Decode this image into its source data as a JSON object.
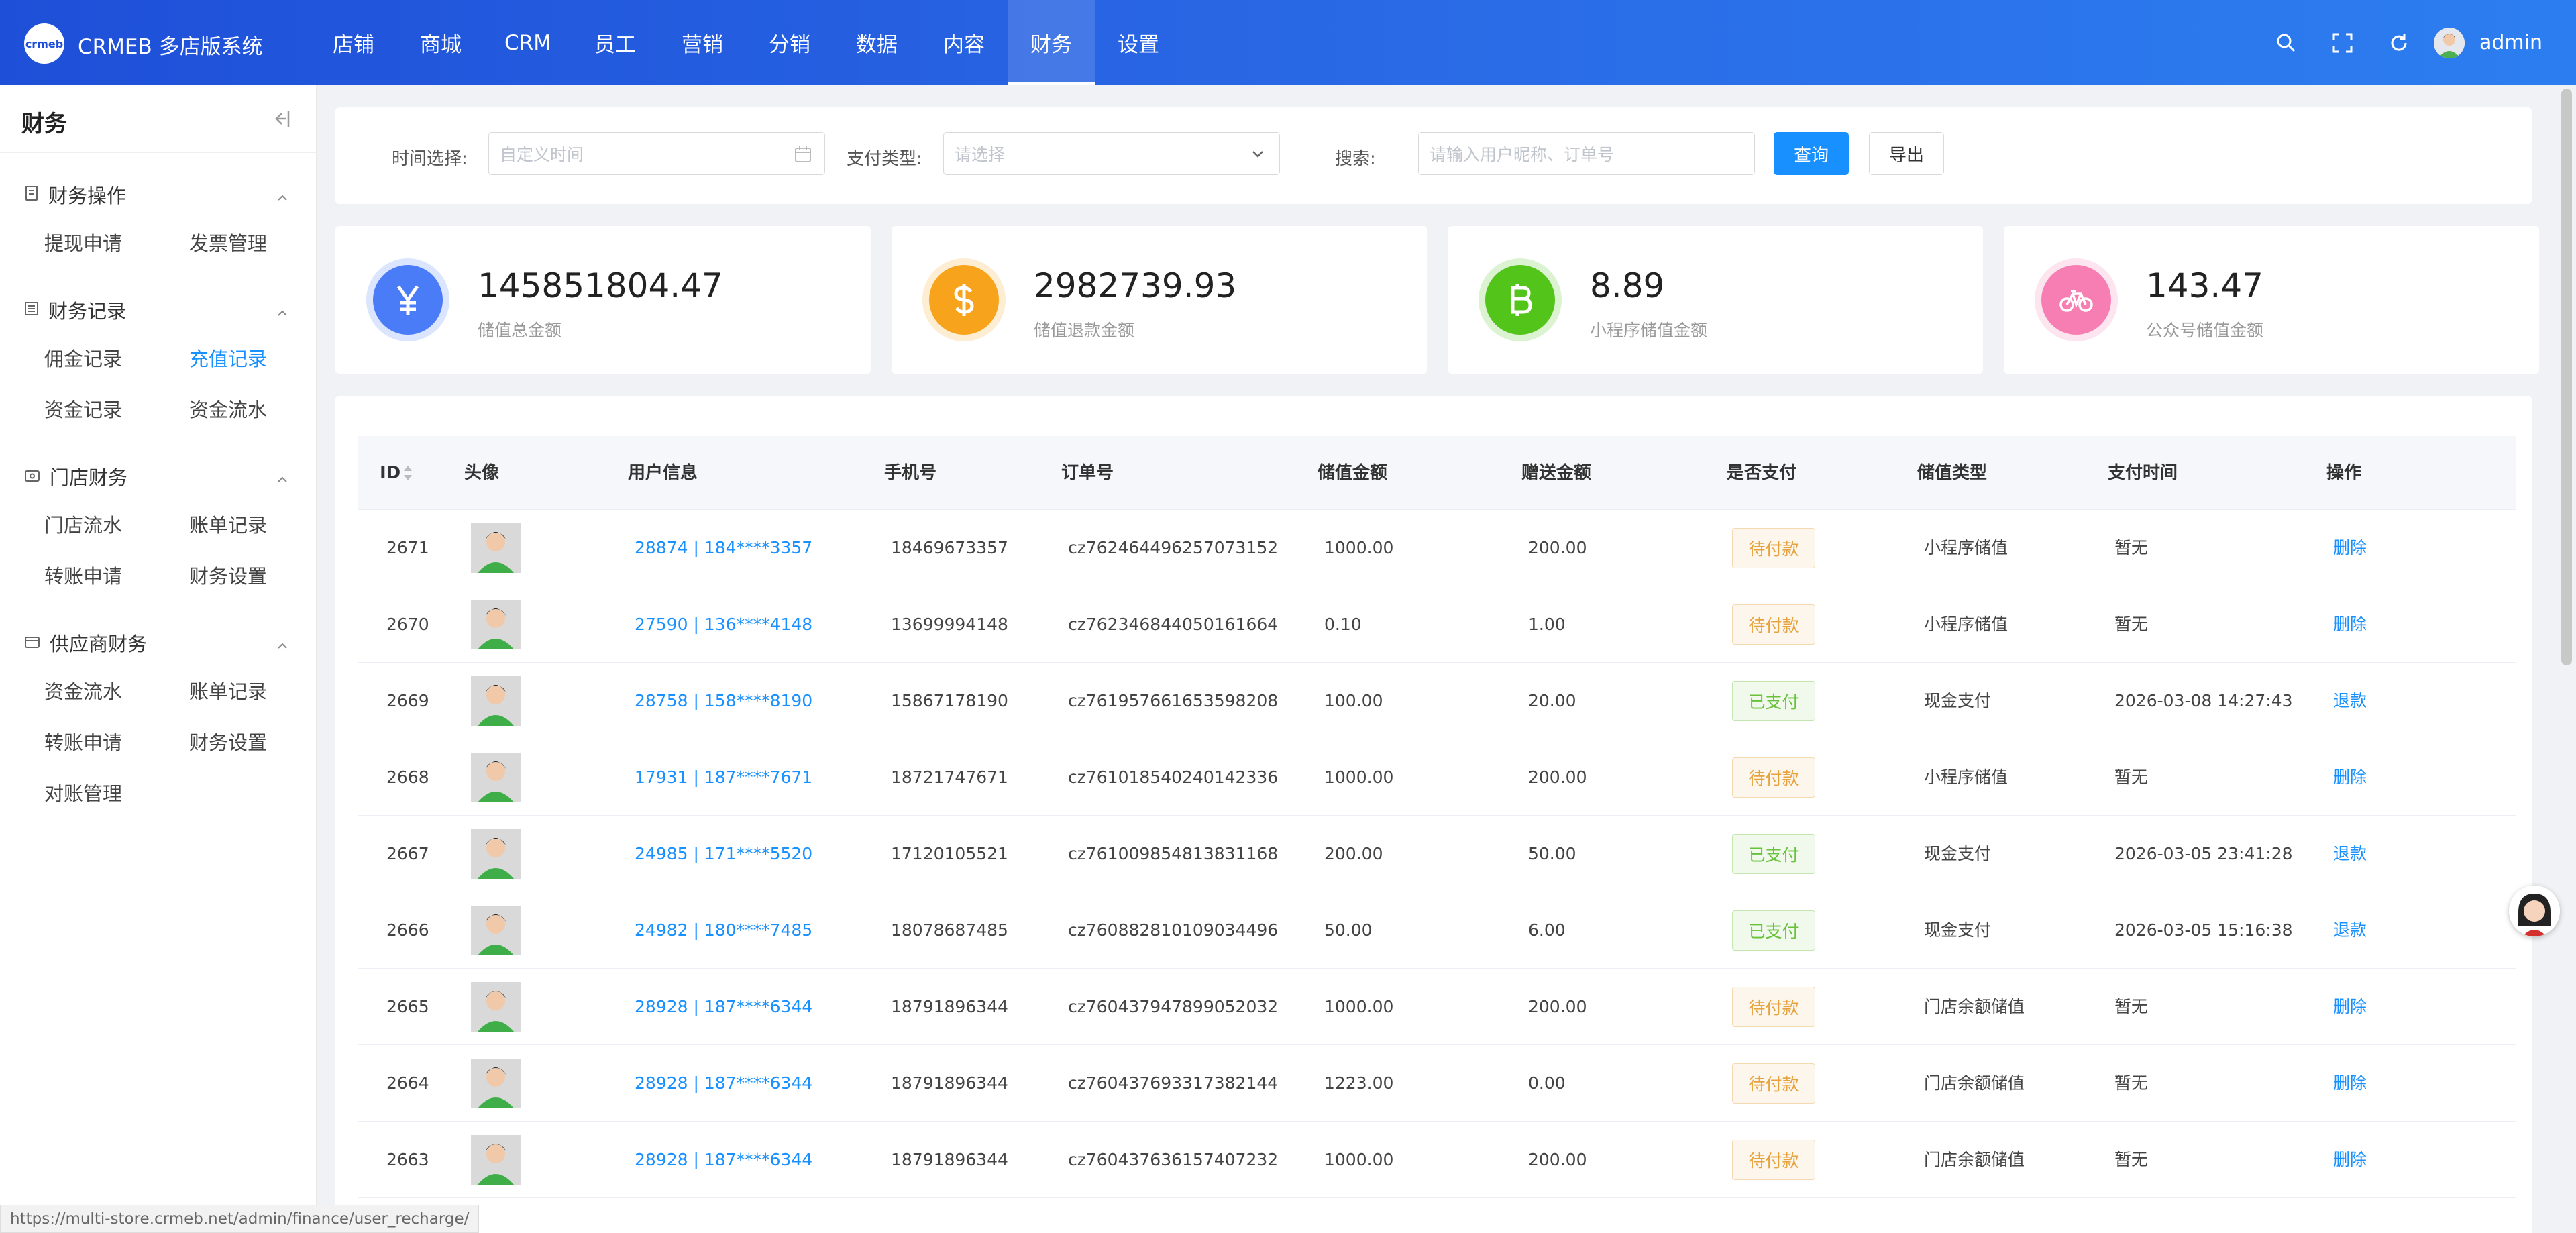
{
  "app": {
    "brand": "CRMEB 多店版系统",
    "logo_text": "crmeb",
    "user": "admin"
  },
  "topnav": [
    {
      "label": "店铺"
    },
    {
      "label": "商城"
    },
    {
      "label": "CRM"
    },
    {
      "label": "员工"
    },
    {
      "label": "营销"
    },
    {
      "label": "分销"
    },
    {
      "label": "数据"
    },
    {
      "label": "内容"
    },
    {
      "label": "财务",
      "active": true
    },
    {
      "label": "设置"
    }
  ],
  "sidebar": {
    "title": "财务",
    "groups": [
      {
        "title": "财务操作",
        "items": [
          "提现申请",
          "发票管理"
        ]
      },
      {
        "title": "财务记录",
        "items": [
          "佣金记录",
          "充值记录",
          "资金记录",
          "资金流水"
        ],
        "active": "充值记录"
      },
      {
        "title": "门店财务",
        "items": [
          "门店流水",
          "账单记录",
          "转账申请",
          "财务设置"
        ]
      },
      {
        "title": "供应商财务",
        "items": [
          "资金流水",
          "账单记录",
          "转账申请",
          "财务设置",
          "对账管理"
        ]
      }
    ]
  },
  "filters": {
    "time_label": "时间选择:",
    "time_placeholder": "自定义时间",
    "pay_label": "支付类型:",
    "pay_placeholder": "请选择",
    "search_label": "搜索:",
    "search_placeholder": "请输入用户昵称、订单号",
    "query_button": "查询",
    "export_button": "导出"
  },
  "stats": [
    {
      "value": "145851804.47",
      "label": "储值总金额",
      "icon": "yuan-icon",
      "color": "#4a7cf7"
    },
    {
      "value": "2982739.93",
      "label": "储值退款金额",
      "icon": "dollar-icon",
      "color": "#f7a31c"
    },
    {
      "value": "8.89",
      "label": "小程序储值金额",
      "icon": "bitcoin-icon",
      "color": "#52c41a"
    },
    {
      "value": "143.47",
      "label": "公众号储值金额",
      "icon": "bicycle-icon",
      "color": "#f77eb3"
    }
  ],
  "table": {
    "columns": [
      "ID",
      "头像",
      "用户信息",
      "手机号",
      "订单号",
      "储值金额",
      "赠送金额",
      "是否支付",
      "储值类型",
      "支付时间",
      "操作"
    ],
    "rows": [
      {
        "id": "2671",
        "user": "28874 | 184****3357",
        "phone": "18469673357",
        "order": "cz762464496257073152",
        "amount": "1000.00",
        "gift": "200.00",
        "paid": "待付款",
        "paid_state": "unpaid",
        "type": "小程序储值",
        "time": "暂无",
        "action": "删除"
      },
      {
        "id": "2670",
        "user": "27590 | 136****4148",
        "phone": "13699994148",
        "order": "cz762346844050161664",
        "amount": "0.10",
        "gift": "1.00",
        "paid": "待付款",
        "paid_state": "unpaid",
        "type": "小程序储值",
        "time": "暂无",
        "action": "删除"
      },
      {
        "id": "2669",
        "user": "28758 | 158****8190",
        "phone": "15867178190",
        "order": "cz761957661653598208",
        "amount": "100.00",
        "gift": "20.00",
        "paid": "已支付",
        "paid_state": "paid",
        "type": "现金支付",
        "time": "2026-03-08 14:27:43",
        "action": "退款"
      },
      {
        "id": "2668",
        "user": "17931 | 187****7671",
        "phone": "18721747671",
        "order": "cz761018540240142336",
        "amount": "1000.00",
        "gift": "200.00",
        "paid": "待付款",
        "paid_state": "unpaid",
        "type": "小程序储值",
        "time": "暂无",
        "action": "删除"
      },
      {
        "id": "2667",
        "user": "24985 | 171****5520",
        "phone": "17120105521",
        "order": "cz761009854813831168",
        "amount": "200.00",
        "gift": "50.00",
        "paid": "已支付",
        "paid_state": "paid",
        "type": "现金支付",
        "time": "2026-03-05 23:41:28",
        "action": "退款"
      },
      {
        "id": "2666",
        "user": "24982 | 180****7485",
        "phone": "18078687485",
        "order": "cz760882810109034496",
        "amount": "50.00",
        "gift": "6.00",
        "paid": "已支付",
        "paid_state": "paid",
        "type": "现金支付",
        "time": "2026-03-05 15:16:38",
        "action": "退款"
      },
      {
        "id": "2665",
        "user": "28928 | 187****6344",
        "phone": "18791896344",
        "order": "cz760437947899052032",
        "amount": "1000.00",
        "gift": "200.00",
        "paid": "待付款",
        "paid_state": "unpaid",
        "type": "门店余额储值",
        "time": "暂无",
        "action": "删除"
      },
      {
        "id": "2664",
        "user": "28928 | 187****6344",
        "phone": "18791896344",
        "order": "cz760437693317382144",
        "amount": "1223.00",
        "gift": "0.00",
        "paid": "待付款",
        "paid_state": "unpaid",
        "type": "门店余额储值",
        "time": "暂无",
        "action": "删除"
      },
      {
        "id": "2663",
        "user": "28928 | 187****6344",
        "phone": "18791896344",
        "order": "cz760437636157407232",
        "amount": "1000.00",
        "gift": "200.00",
        "paid": "待付款",
        "paid_state": "unpaid",
        "type": "门店余额储值",
        "time": "暂无",
        "action": "删除"
      }
    ]
  },
  "statusbar": {
    "url": "https://multi-store.crmeb.net/admin/finance/user_recharge/"
  }
}
